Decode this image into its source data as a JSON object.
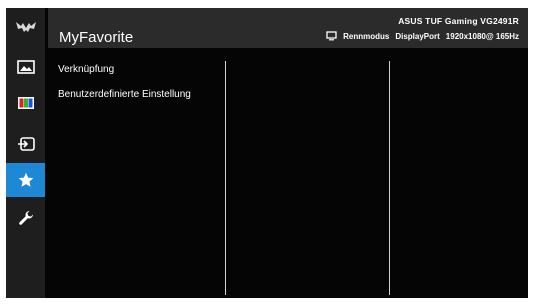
{
  "sidebar": {
    "items": [
      {
        "icon": "tuf-gaming-logo-icon"
      },
      {
        "icon": "image-icon"
      },
      {
        "icon": "color-bars-icon"
      },
      {
        "icon": "input-source-icon"
      },
      {
        "icon": "star-icon",
        "active": true
      },
      {
        "icon": "wrench-icon"
      }
    ]
  },
  "header": {
    "title": "MyFavorite",
    "model": "ASUS  TUF  Gaming   VG2491R",
    "status": {
      "mode_icon": "monitor-icon",
      "mode": "Rennmodus",
      "input": "DisplayPort",
      "resolution": "1920x1080@ 165Hz"
    }
  },
  "menu": {
    "items": [
      {
        "label": "Verknüpfung"
      },
      {
        "label": "Benutzerdefinierte Einstellung"
      }
    ]
  },
  "colors": {
    "accent": "#1e88d4",
    "sidebar": "#1e1e1e",
    "header": "#2b2b2b",
    "background": "#050505"
  }
}
